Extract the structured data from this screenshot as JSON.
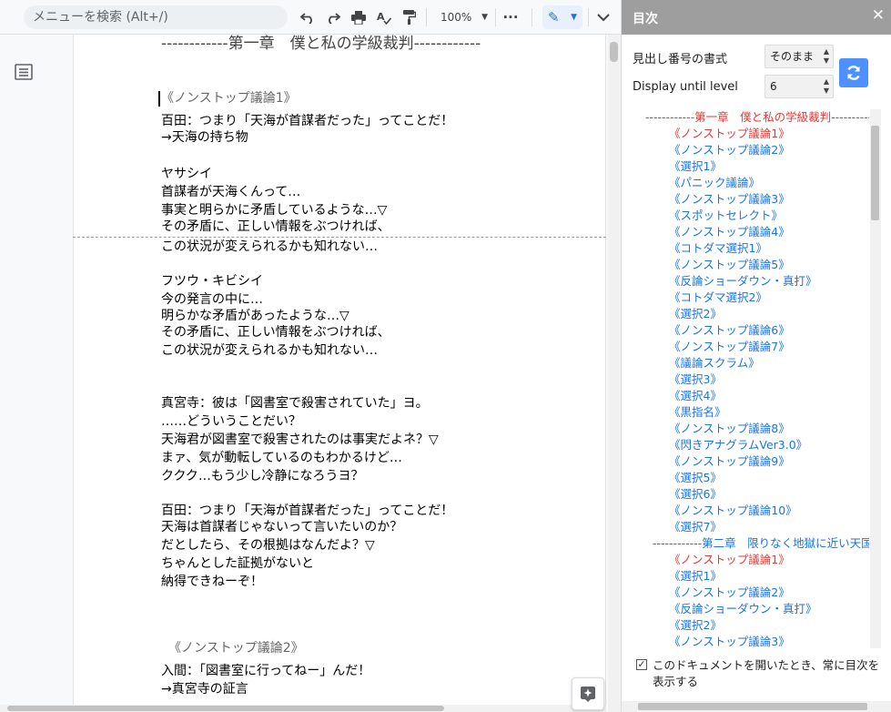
{
  "toolbar": {
    "menu_search_placeholder": "メニューを検索 (Alt+/)",
    "zoom": "100%",
    "icons": [
      "undo-icon",
      "redo-icon",
      "print-icon",
      "spellcheck-icon",
      "paint-format-icon",
      "more-icon",
      "pen-icon",
      "collapse-icon"
    ]
  },
  "document": {
    "lines": [
      "------------第一章　僕と私の学級裁判------------",
      "《ノンストップ議論1》",
      "百田：つまり「天海が首謀者だった」ってことだ！",
      "→天海の持ち物",
      "",
      "ヤサシイ",
      "首謀者が天海くんって…",
      "事実と明らかに矛盾しているような…▽",
      "その矛盾に、正しい情報をぶつければ、",
      "この状況が変えられるかも知れない…",
      "",
      "フツウ・キビシイ",
      "今の発言の中に…",
      "明らかな矛盾があったような…▽",
      "その矛盾に、正しい情報をぶつければ、",
      "この状況が変えられるかも知れない…",
      "",
      "",
      "真宮寺：彼は「図書室で殺害されていた」ヨ。",
      "……どういうことだい？",
      "天海君が図書室で殺害されたのは事実だよネ？▽",
      "まァ、気が動転しているのもわかるけど…",
      "ククク…もう少し冷静になろうヨ？",
      "",
      "百田：つまり「天海が首謀者だった」ってことだ！",
      "天海は首謀者じゃないって言いたいのか？",
      "だとしたら、その根拠はなんだよ？▽",
      "ちゃんとした証拠がないと",
      "納得できねーぞ！",
      "",
      "",
      "",
      "《ノンストップ議論2》",
      "入間：「図書室に行ってねー」んだ！",
      "→真宮寺の証言"
    ]
  },
  "toc_panel": {
    "title": "目次",
    "close": "✕",
    "heading_format_label": "見出し番号の書式",
    "heading_format_value": "そのまま",
    "display_level_label": "Display until level",
    "display_level_value": "6",
    "items": [
      {
        "text": "------------第一章　僕と私の学級裁判------------",
        "level": 1,
        "color": "red"
      },
      {
        "text": "《ノンストップ議論1》",
        "level": 2,
        "color": "red"
      },
      {
        "text": "《ノンストップ議論2》",
        "level": 2,
        "color": "blue"
      },
      {
        "text": "《選択1》",
        "level": 2,
        "color": "blue"
      },
      {
        "text": "《パニック議論》",
        "level": 2,
        "color": "blue"
      },
      {
        "text": "《ノンストップ議論3》",
        "level": 2,
        "color": "blue"
      },
      {
        "text": "《スポットセレクト》",
        "level": 2,
        "color": "blue"
      },
      {
        "text": "《ノンストップ議論4》",
        "level": 2,
        "color": "blue"
      },
      {
        "text": "《コトダマ選択1》",
        "level": 2,
        "color": "blue"
      },
      {
        "text": "《ノンストップ議論5》",
        "level": 2,
        "color": "blue"
      },
      {
        "text": "《反論ショーダウン・真打》",
        "level": 2,
        "color": "blue"
      },
      {
        "text": "《コトダマ選択2》",
        "level": 2,
        "color": "blue"
      },
      {
        "text": "《選択2》",
        "level": 2,
        "color": "blue"
      },
      {
        "text": "《ノンストップ議論6》",
        "level": 2,
        "color": "blue"
      },
      {
        "text": "《ノンストップ議論7》",
        "level": 2,
        "color": "blue"
      },
      {
        "text": "《議論スクラム》",
        "level": 2,
        "color": "blue"
      },
      {
        "text": "《選択3》",
        "level": 2,
        "color": "blue"
      },
      {
        "text": "《選択4》",
        "level": 2,
        "color": "blue"
      },
      {
        "text": "《黒指名》",
        "level": 2,
        "color": "blue"
      },
      {
        "text": "《ノンストップ議論8》",
        "level": 2,
        "color": "blue"
      },
      {
        "text": "《閃きアナグラムVer3.0》",
        "level": 2,
        "color": "blue"
      },
      {
        "text": "《ノンストップ議論9》",
        "level": 2,
        "color": "blue"
      },
      {
        "text": "《選択5》",
        "level": 2,
        "color": "blue"
      },
      {
        "text": "《選択6》",
        "level": 2,
        "color": "blue"
      },
      {
        "text": "《ノンストップ議論10》",
        "level": 2,
        "color": "blue"
      },
      {
        "text": "《選択7》",
        "level": 2,
        "color": "blue"
      },
      {
        "text": "------------第二章　限りなく地獄に近い天国",
        "level": 1,
        "color": "blue"
      },
      {
        "text": "《ノンストップ議論1》",
        "level": 2,
        "color": "red"
      },
      {
        "text": "《選択1》",
        "level": 2,
        "color": "blue"
      },
      {
        "text": "《ノンストップ議論2》",
        "level": 2,
        "color": "blue"
      },
      {
        "text": "《反論ショーダウン・真打》",
        "level": 2,
        "color": "blue"
      },
      {
        "text": "《選択2》",
        "level": 2,
        "color": "blue"
      },
      {
        "text": "《ノンストップ議論3》",
        "level": 2,
        "color": "blue"
      }
    ],
    "checkbox_checked": true,
    "checkbox_label": "このドキュメントを開いたとき、常に目次を表示する"
  },
  "colors": {
    "toc_red": "#e53935",
    "toc_blue": "#1a73e8",
    "header_gray": "#9e9e9e",
    "refresh_blue": "#4d90fe"
  }
}
